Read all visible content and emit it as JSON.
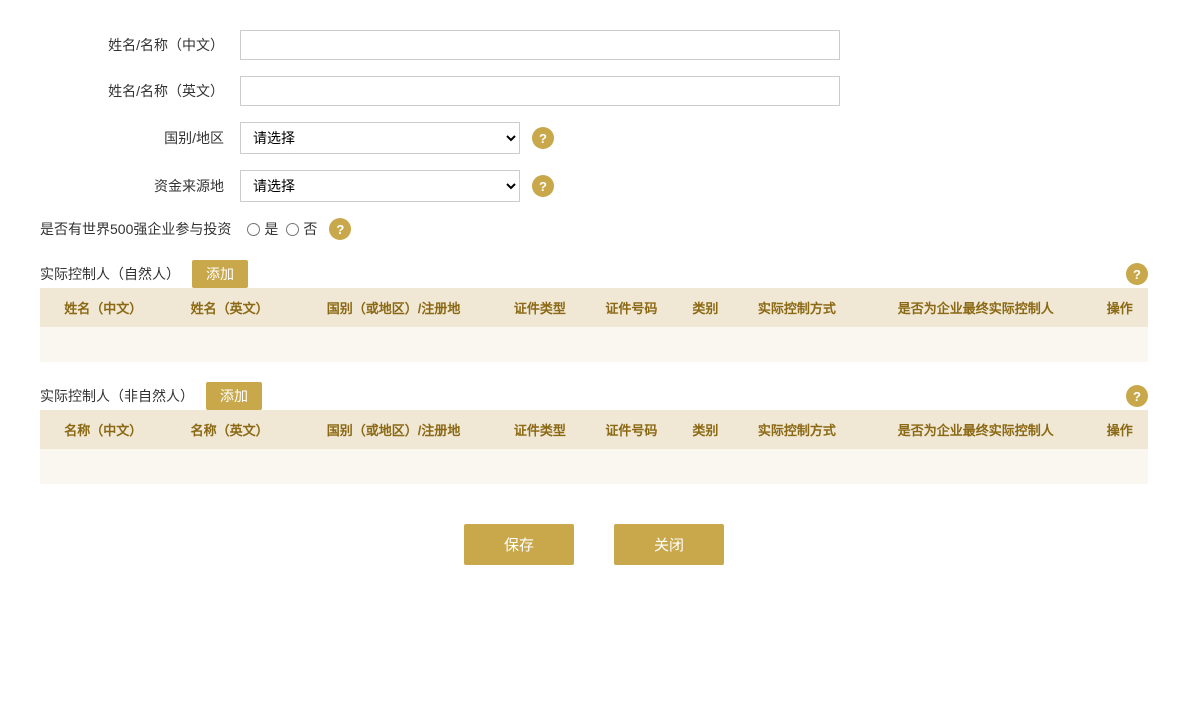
{
  "form": {
    "name_cn_label": "姓名/名称（中文）",
    "name_en_label": "姓名/名称（英文）",
    "country_label": "国别/地区",
    "country_placeholder": "请选择",
    "fund_source_label": "资金来源地",
    "fund_source_placeholder": "请选择",
    "fortune500_label": "是否有世界500强企业参与投资",
    "fortune500_yes": "是",
    "fortune500_no": "否",
    "name_cn_value": "",
    "name_en_value": ""
  },
  "natural_person": {
    "section_label": "实际控制人（自然人）",
    "add_btn": "添加",
    "columns": [
      "姓名（中文）",
      "姓名（英文）",
      "国别（或地区）/注册地",
      "证件类型",
      "证件号码",
      "类别",
      "实际控制方式",
      "是否为企业最终实际控制人",
      "操作"
    ]
  },
  "non_natural_person": {
    "section_label": "实际控制人（非自然人）",
    "add_btn": "添加",
    "columns": [
      "名称（中文）",
      "名称（英文）",
      "国别（或地区）/注册地",
      "证件类型",
      "证件号码",
      "类别",
      "实际控制方式",
      "是否为企业最终实际控制人",
      "操作"
    ]
  },
  "buttons": {
    "save": "保存",
    "close": "关闭"
  },
  "help_icon": "?",
  "colors": {
    "gold": "#c8a84b",
    "table_header_bg": "#f0e8d5",
    "table_body_bg": "#faf7f0"
  }
}
